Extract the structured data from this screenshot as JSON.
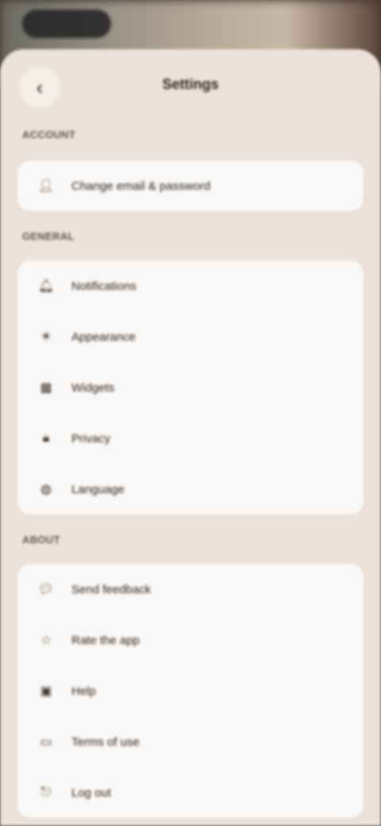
{
  "header": {
    "back_icon": "chevron-left-icon",
    "title": "Settings"
  },
  "sections": [
    {
      "label": "ACCOUNT",
      "items": [
        {
          "label": "Change email & password",
          "icon": "person-icon"
        }
      ]
    },
    {
      "label": "GENERAL",
      "items": [
        {
          "label": "Notifications",
          "icon": "bell-icon"
        },
        {
          "label": "Appearance",
          "icon": "sun-icon"
        },
        {
          "label": "Widgets",
          "icon": "grid-icon"
        },
        {
          "label": "Privacy",
          "icon": "lock-icon"
        },
        {
          "label": "Language",
          "icon": "globe-icon"
        }
      ]
    },
    {
      "label": "ABOUT",
      "items": [
        {
          "label": "Send feedback",
          "icon": "chat-icon"
        },
        {
          "label": "Rate the app",
          "icon": "star-icon"
        },
        {
          "label": "Help",
          "icon": "help-icon"
        },
        {
          "label": "Terms of use",
          "icon": "document-icon"
        },
        {
          "label": "Log out",
          "icon": "logout-icon"
        }
      ]
    }
  ]
}
